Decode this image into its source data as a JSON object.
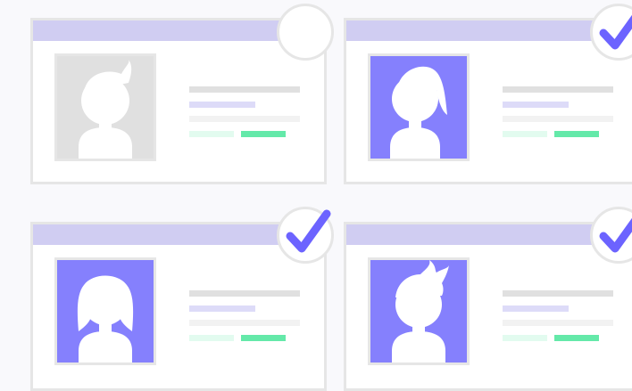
{
  "colors": {
    "background": "#f9f9fc",
    "card_border": "#e6e6e6",
    "header": "#d0cdf2",
    "accent": "#6c63ff",
    "avatar_fill": "#8580fd",
    "avatar_placeholder": "#e0e0e0",
    "line_gray": "#e0e0e0",
    "line_light_gray": "#f2f2f2",
    "line_lavender": "#dddbf8",
    "line_mint": "#e2fbef",
    "line_green": "#64e9a9"
  },
  "cards": [
    {
      "avatar_icon": "person-short-hair-icon",
      "selected": false
    },
    {
      "avatar_icon": "person-ponytail-icon",
      "selected": true
    },
    {
      "avatar_icon": "person-long-hair-icon",
      "selected": true
    },
    {
      "avatar_icon": "person-spiky-hair-icon",
      "selected": true
    }
  ]
}
